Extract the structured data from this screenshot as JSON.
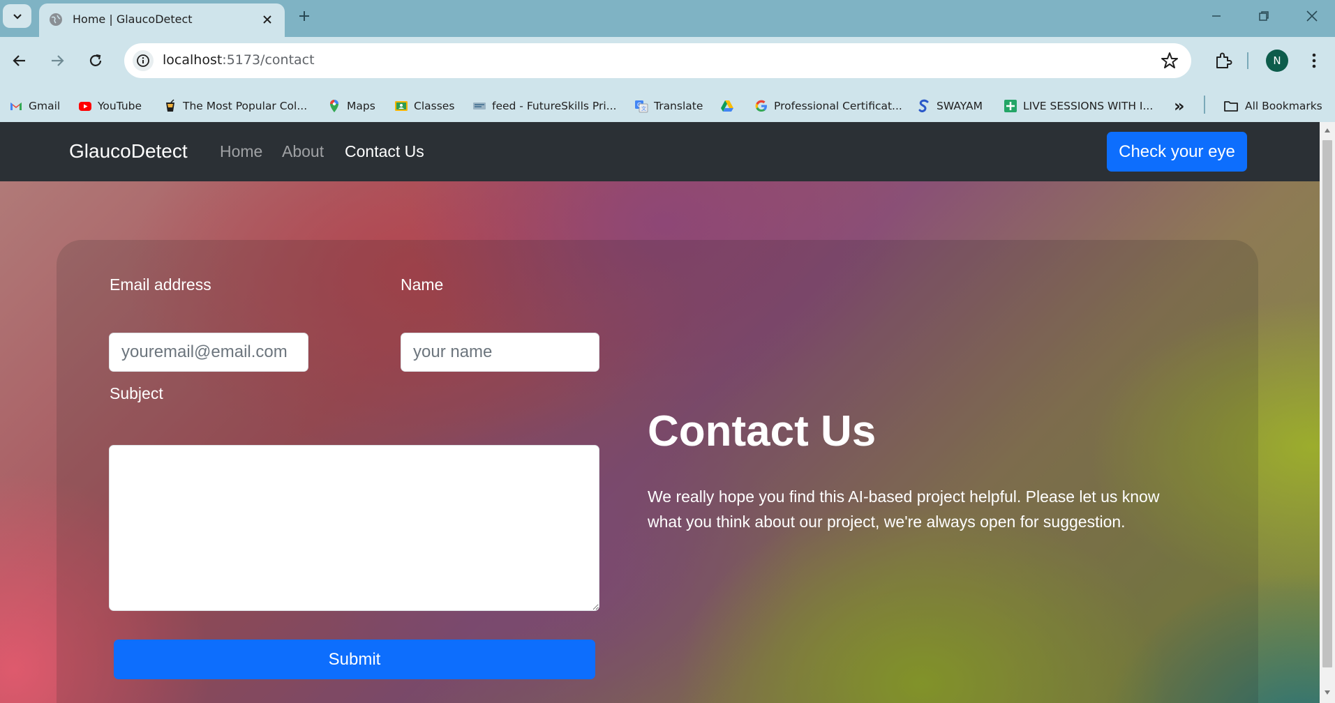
{
  "browser": {
    "tab_title": "Home | GlaucoDetect",
    "url_host": "localhost",
    "url_path": ":5173/contact",
    "profile_initial": "N",
    "bookmarks": [
      {
        "label": "Gmail",
        "icon": "gmail-icon"
      },
      {
        "label": "YouTube",
        "icon": "youtube-icon"
      },
      {
        "label": "The Most Popular Col...",
        "icon": "drink-icon"
      },
      {
        "label": "Maps",
        "icon": "maps-icon"
      },
      {
        "label": "Classes",
        "icon": "classroom-icon"
      },
      {
        "label": "feed - FutureSkills Pri...",
        "icon": "futureskills-icon"
      },
      {
        "label": "Translate",
        "icon": "translate-icon"
      },
      {
        "label": "",
        "icon": "drive-icon"
      },
      {
        "label": "Professional Certificat...",
        "icon": "google-icon"
      },
      {
        "label": "SWAYAM",
        "icon": "swayam-icon"
      },
      {
        "label": "LIVE SESSIONS WITH I...",
        "icon": "sheets-icon"
      }
    ],
    "more_bookmarks": "»",
    "all_bookmarks": "All Bookmarks"
  },
  "navbar": {
    "brand": "GlaucoDetect",
    "links": [
      {
        "label": "Home",
        "active": false
      },
      {
        "label": "About",
        "active": false
      },
      {
        "label": "Contact Us",
        "active": true
      }
    ],
    "cta": "Check your eye"
  },
  "form": {
    "email_label": "Email address",
    "email_placeholder": "youremail@email.com",
    "email_value": "",
    "name_label": "Name",
    "name_placeholder": "your name",
    "name_value": "",
    "subject_label": "Subject",
    "subject_value": "",
    "submit": "Submit"
  },
  "contact": {
    "title": "Contact Us",
    "text": "We really hope you find this AI-based project helpful. Please let us know what you think about our project, we're always open for suggestion."
  },
  "colors": {
    "navbar_bg": "#2b3035",
    "primary": "#0d6efd",
    "tabbar_bg": "#7fb3c4",
    "toolbar_bg": "#cfe4eb"
  }
}
